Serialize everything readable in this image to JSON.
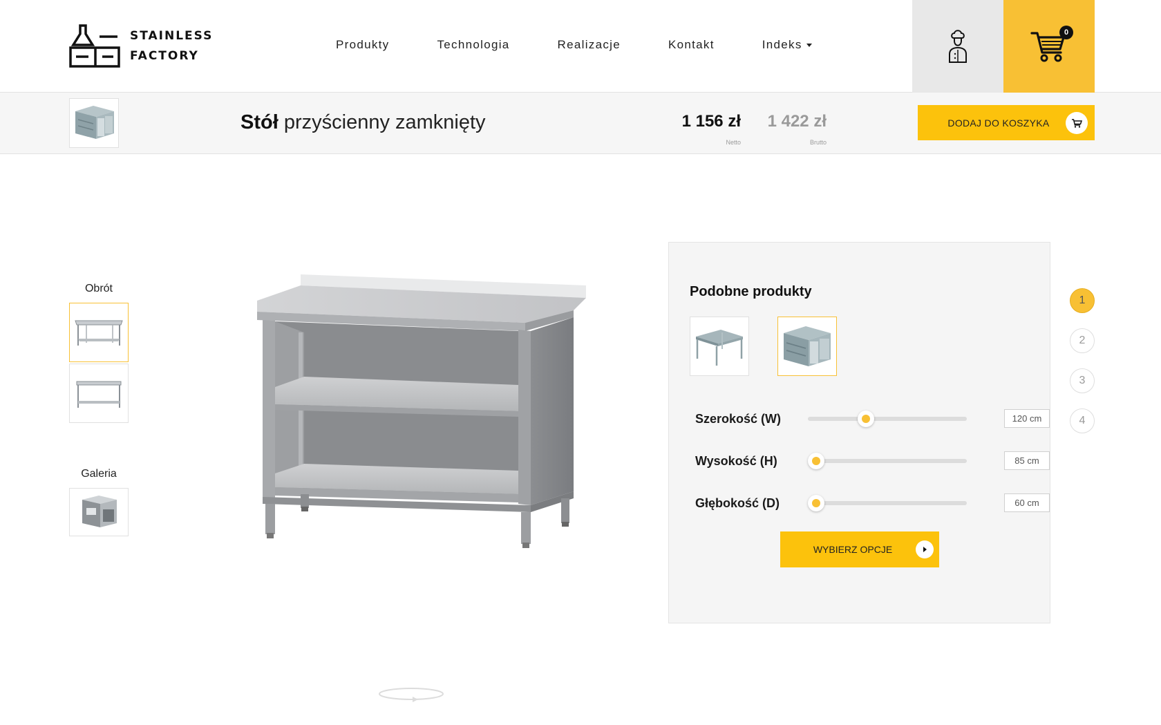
{
  "header": {
    "logo_line1": "STAINLESS",
    "logo_line2": "FACTORY",
    "nav": [
      "Produkty",
      "Technologia",
      "Realizacje",
      "Kontakt",
      "Indeks"
    ],
    "cart_count": "0"
  },
  "product_bar": {
    "title_bold": "Stół",
    "title_rest": " przyścienny zamknięty",
    "price_net": "1 156 zł",
    "price_net_label": "Netto",
    "price_gross": "1 422 zł",
    "price_gross_label": "Brutto",
    "add_to_cart": "DODAJ DO KOSZYKA"
  },
  "sidebar": {
    "rotation_label": "Obrót",
    "gallery_label": "Galeria"
  },
  "options": {
    "title": "Podobne produkty",
    "dimensions": [
      {
        "label": "Szerokość (W)",
        "value": "120 cm",
        "slider_fraction": 0.35
      },
      {
        "label": "Wysokość (H)",
        "value": "85 cm",
        "slider_fraction": 0.0
      },
      {
        "label": "Głębokość (D)",
        "value": "60 cm",
        "slider_fraction": 0.0
      }
    ],
    "choose_button": "WYBIERZ OPCJE"
  },
  "steps": [
    "1",
    "2",
    "3",
    "4"
  ],
  "colors": {
    "accent": "#f8c034",
    "button": "#fcc20c",
    "panel": "#f5f5f5"
  }
}
